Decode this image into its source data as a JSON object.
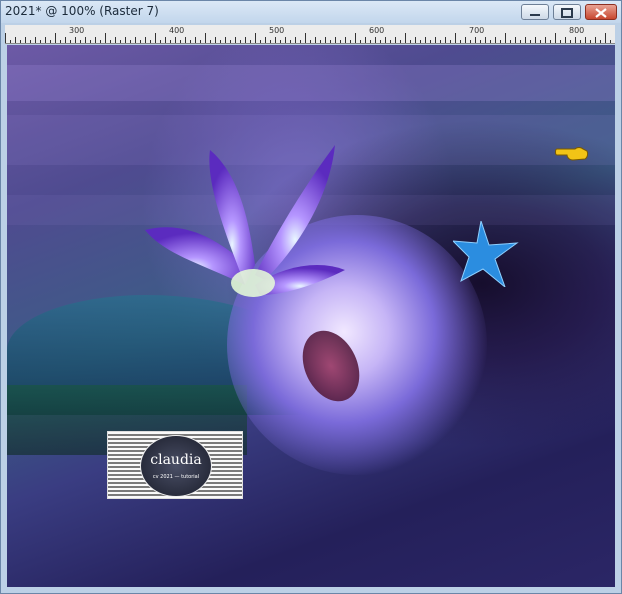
{
  "window": {
    "title": "2021* @ 100% (Raster 7)",
    "controls": [
      "minimize",
      "maximize",
      "close"
    ]
  },
  "ruler": {
    "labels": [
      "300",
      "400",
      "500",
      "600",
      "700",
      "800"
    ]
  },
  "canvas": {
    "logo_text": "claudia",
    "logo_subtext": "cv 2021 — tutorial"
  },
  "icons": {
    "minimize": "minimize-icon",
    "maximize": "maximize-icon",
    "close": "close-icon",
    "cursor": "pointing-hand-icon",
    "star": "star-icon"
  },
  "colors": {
    "title_bg": "#c2d6ec",
    "close_button": "#c7472f",
    "star": "#2b8de0",
    "cursor": "#f2c416"
  }
}
